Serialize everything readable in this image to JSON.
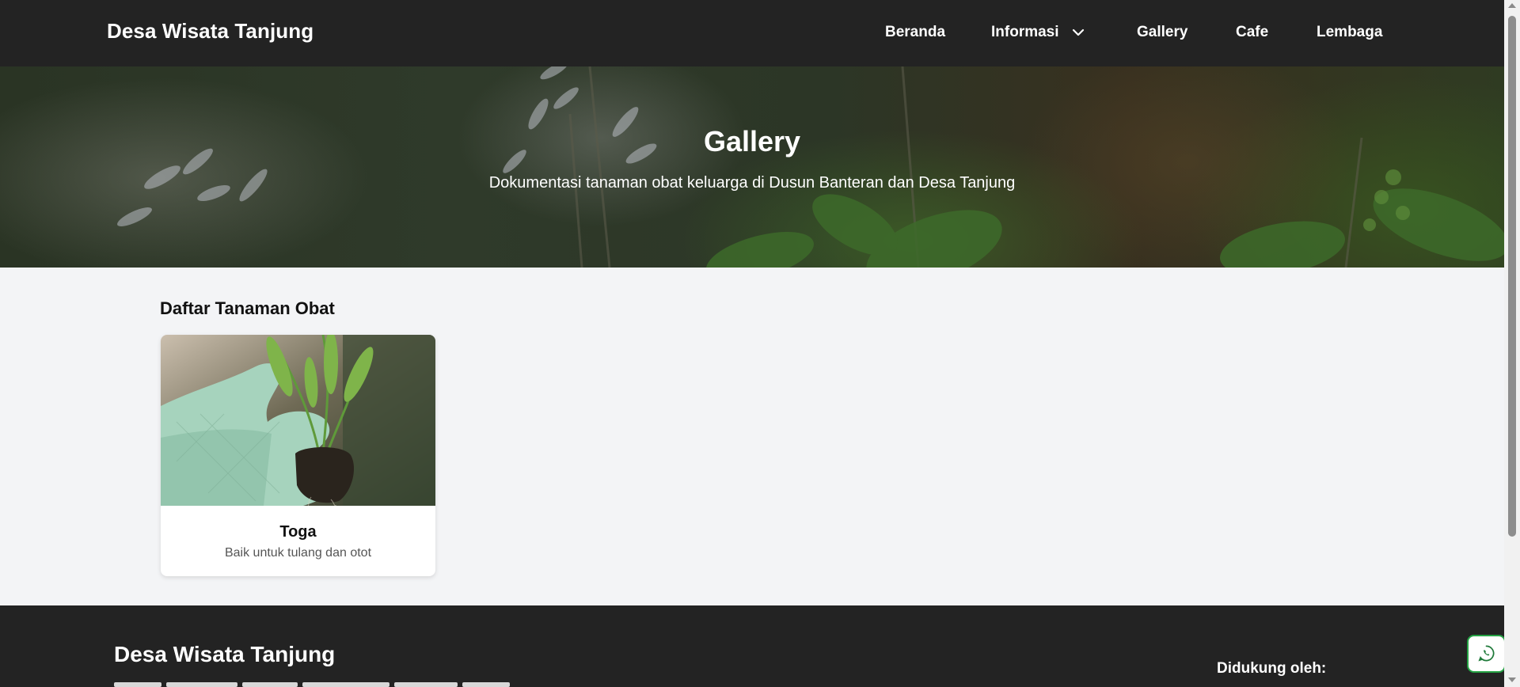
{
  "nav": {
    "brand": "Desa Wisata Tanjung",
    "items": [
      "Beranda",
      "Informasi",
      "Gallery",
      "Cafe",
      "Lembaga"
    ],
    "dropdown_icon": "chevron-down-icon"
  },
  "hero": {
    "title": "Gallery",
    "subtitle": "Dokumentasi tanaman obat keluarga di Dusun Banteran dan Desa Tanjung"
  },
  "main": {
    "section_title": "Daftar Tanaman Obat",
    "cards": [
      {
        "title": "Toga",
        "description": "Baik untuk tulang dan otot"
      }
    ]
  },
  "footer": {
    "brand": "Desa Wisata Tanjung",
    "supported_label": "Didukung oleh:"
  },
  "floating": {
    "icon": "whatsapp-icon",
    "color": "#25a244"
  },
  "colors": {
    "navbar": "#232323",
    "page_bg": "#f3f4f6"
  }
}
